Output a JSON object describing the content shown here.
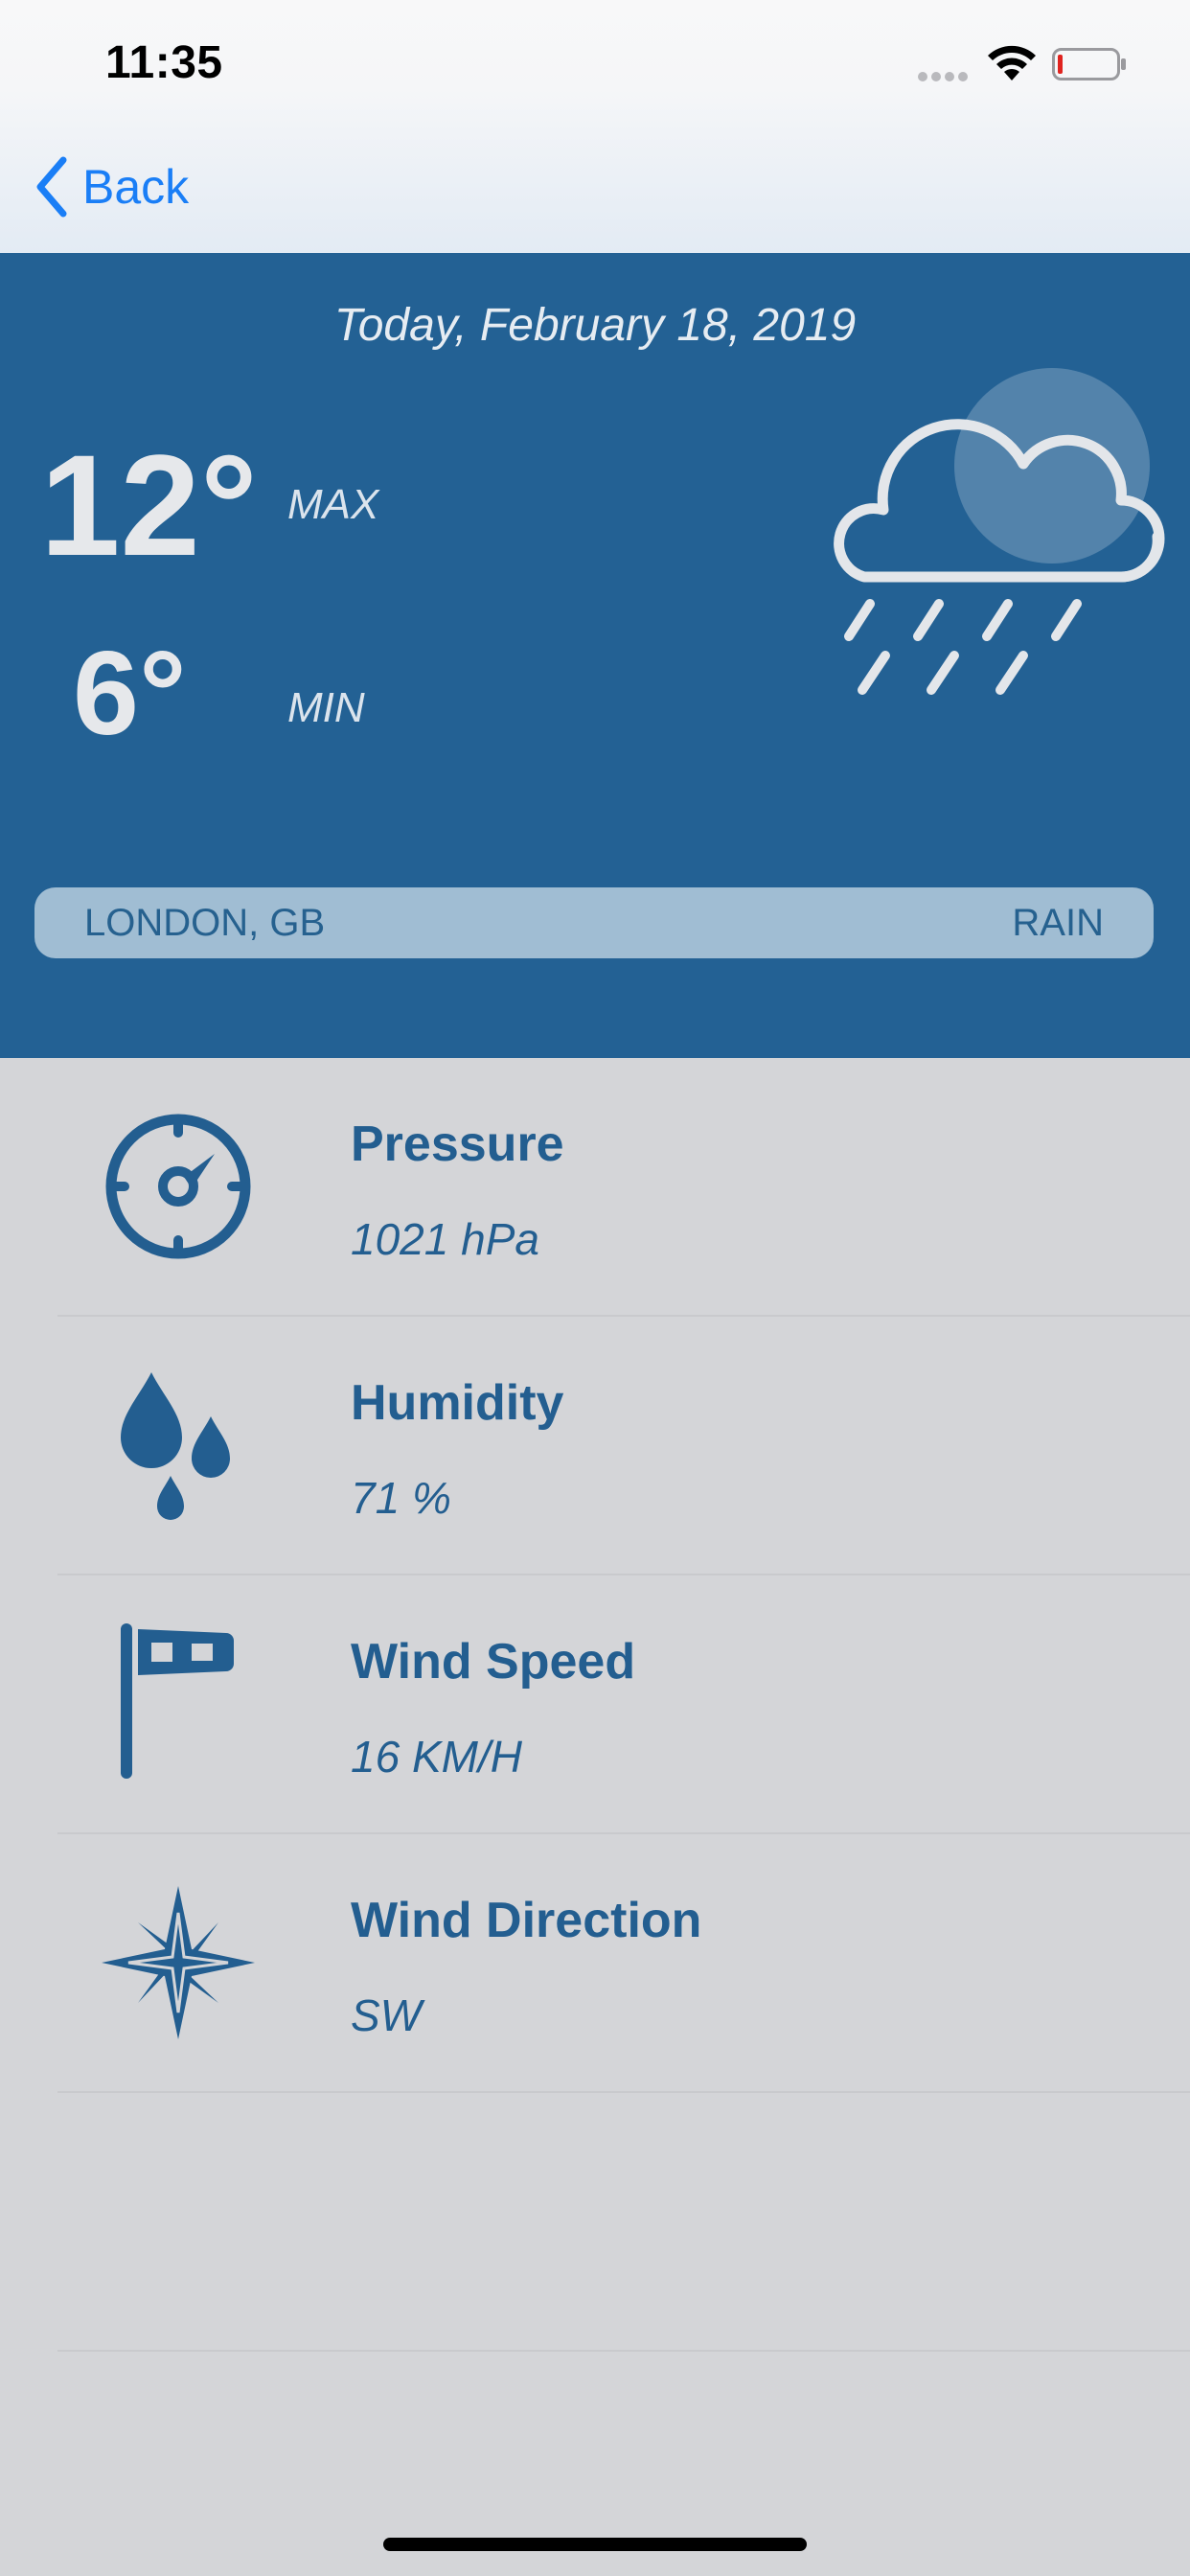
{
  "status_bar": {
    "time": "11:35"
  },
  "nav": {
    "back_label": "Back"
  },
  "weather": {
    "date": "Today, February 18, 2019",
    "max_temp": "12°",
    "max_label": "MAX",
    "min_temp": "6°",
    "min_label": "MIN",
    "location": "LONDON, GB",
    "condition": "RAIN",
    "icon": "cloud-rain-sun-icon"
  },
  "details": [
    {
      "title": "Pressure",
      "value": "1021 hPa",
      "icon": "compass-gauge-icon"
    },
    {
      "title": "Humidity",
      "value": "71 %",
      "icon": "water-drops-icon"
    },
    {
      "title": "Wind Speed",
      "value": "16 KM/H",
      "icon": "windsock-icon"
    },
    {
      "title": "Wind Direction",
      "value": "SW",
      "icon": "compass-rose-icon"
    }
  ],
  "colors": {
    "accent_blue": "#236194",
    "ios_link_blue": "#1a7ef6",
    "background_gray": "#d4d5d8",
    "pill_bg": "#a0bdd3"
  }
}
